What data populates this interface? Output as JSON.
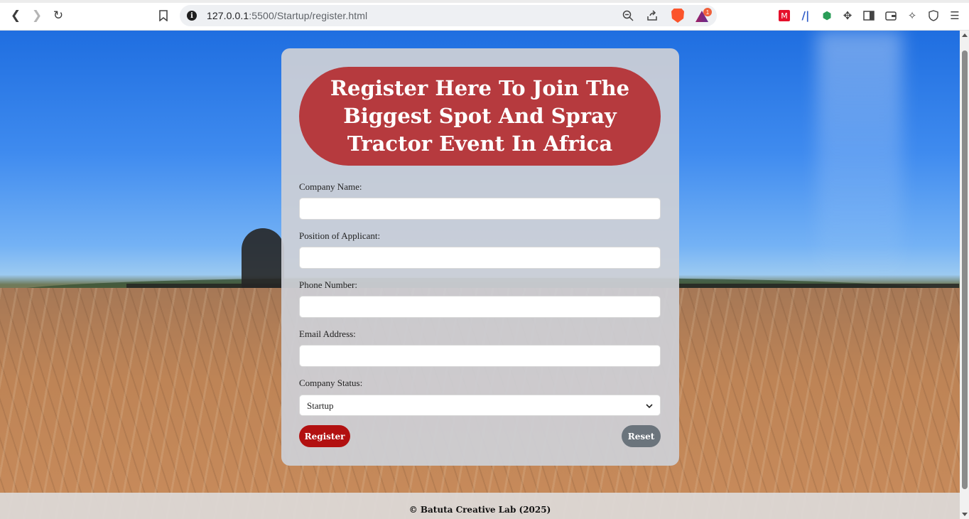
{
  "browser": {
    "url_host": "127.0.0.1",
    "url_path": ":5500/Startup/register.html",
    "rewards_badge": "1"
  },
  "form": {
    "heading": "Register Here To Join The Biggest Spot And Spray Tractor Event In Africa",
    "fields": [
      {
        "label": "Company Name:",
        "value": ""
      },
      {
        "label": "Position of Applicant:",
        "value": ""
      },
      {
        "label": "Phone Number:",
        "value": ""
      },
      {
        "label": "Email Address:",
        "value": ""
      }
    ],
    "status_label": "Company Status:",
    "status_value": "Startup",
    "register_label": "Register",
    "reset_label": "Reset"
  },
  "footer": {
    "text": "© Batuta Creative Lab (2025)"
  },
  "colors": {
    "heading_bg": "#b63a3e",
    "register_bg": "#b21010",
    "reset_bg": "#6b747c"
  }
}
